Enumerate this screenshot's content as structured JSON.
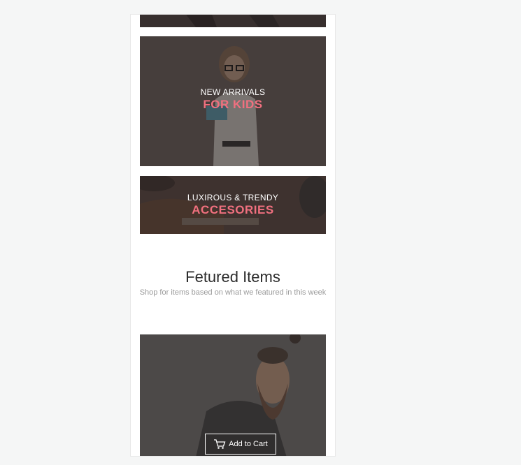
{
  "banners": {
    "kids": {
      "pre": "NEW ARRIVALS",
      "headline": "FOR KIDS"
    },
    "accessories": {
      "pre": "LUXIROUS & TRENDY",
      "headline": "ACCESORIES"
    }
  },
  "featured": {
    "title": "Fetured Items",
    "subtitle": "Shop for items based on what we featured in this week"
  },
  "product": {
    "add_to_cart_label": "Add to Cart",
    "cart_icon": "cart-icon"
  },
  "colors": {
    "accent": "#f0707f",
    "overlay": "#3a3232",
    "background": "#f5f6f6"
  }
}
